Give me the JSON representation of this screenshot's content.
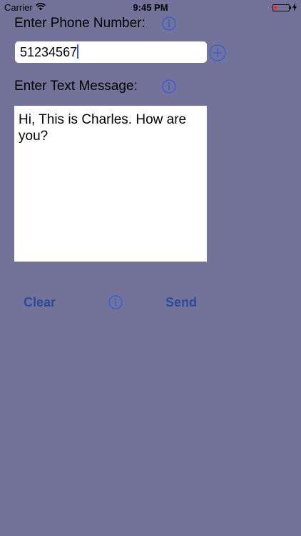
{
  "status_bar": {
    "carrier": "Carrier",
    "time": "9:45 PM",
    "wifi_icon": "wifi-icon",
    "battery_icon": "battery-low-icon",
    "battery_level": 0.2,
    "charging_icon": "lightning-bolt-icon"
  },
  "phone": {
    "label": "Enter Phone Number:",
    "value": "51234567",
    "info_icon": "info-icon",
    "add_icon": "add-contact-icon"
  },
  "message": {
    "label": "Enter Text Message:",
    "value": "Hi, This is Charles. How are you?",
    "info_icon": "info-icon"
  },
  "actions": {
    "clear_label": "Clear",
    "send_label": "Send",
    "info_icon": "info-icon"
  },
  "colors": {
    "background": "#737399",
    "accent": "#2f5de0",
    "button_text": "#2d4a9e"
  }
}
